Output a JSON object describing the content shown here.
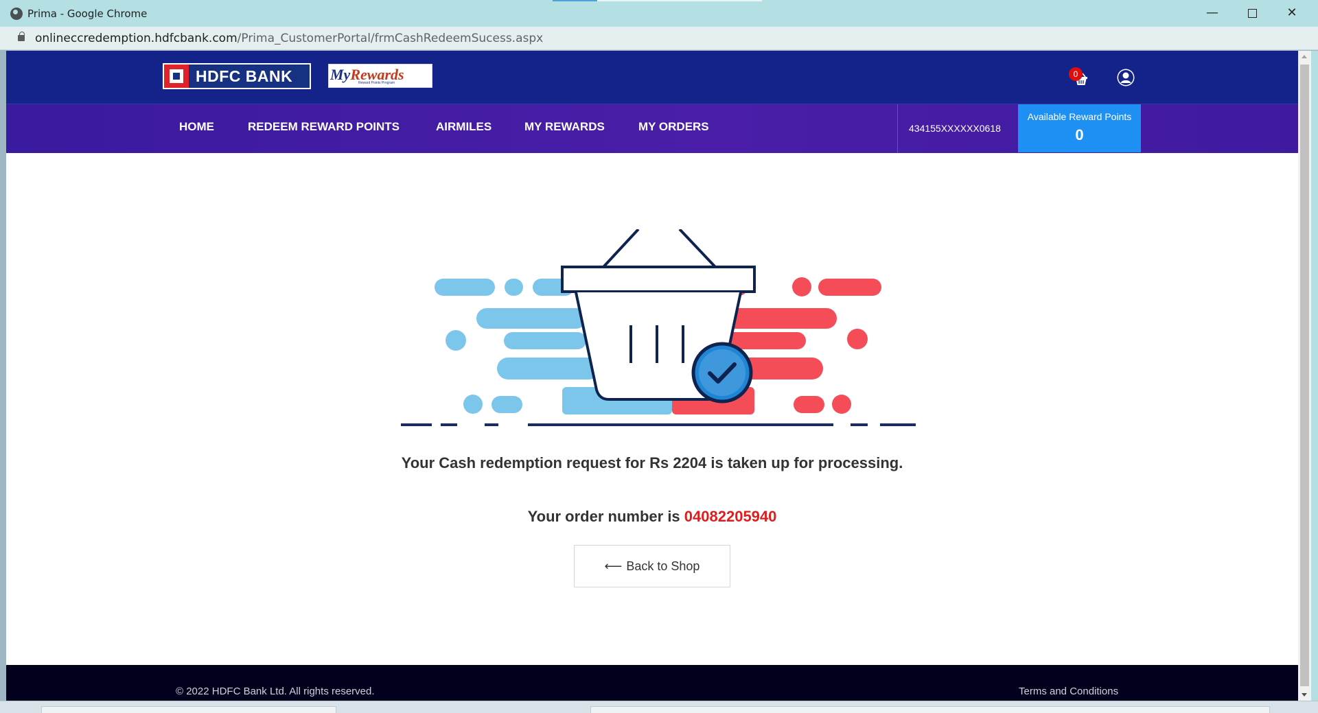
{
  "window": {
    "title": "Prima - Google Chrome",
    "url_host": "onlineccredemption.hdfcbank.com",
    "url_path": "/Prima_CustomerPortal/frmCashRedeemSucess.aspx"
  },
  "header": {
    "bank_name": "HDFC BANK",
    "rewards_logo_my": "My",
    "rewards_logo_rest": "Rewards",
    "rewards_logo_sub": "Reward Points Program",
    "cart_count": "0",
    "icons": [
      "shopping-basket-icon",
      "user-icon"
    ]
  },
  "nav": {
    "items": [
      "HOME",
      "REDEEM REWARD POINTS",
      "AIRMILES",
      "MY REWARDS",
      "MY ORDERS"
    ],
    "card_number": "434155XXXXXX0618",
    "reward_label": "Available Reward Points",
    "reward_points": "0"
  },
  "main": {
    "message": "Your Cash redemption request for Rs 2204 is taken up for processing.",
    "order_prefix": "Your order number is",
    "order_number": "04082205940",
    "back_arrow": "⟵",
    "back_label": "Back to Shop"
  },
  "footer": {
    "copyright": "© 2022 HDFC Bank Ltd. All rights reserved.",
    "terms": "Terms and Conditions"
  },
  "colors": {
    "header_bg": "#13238a",
    "nav_bg": "#4a1ea8",
    "reward_box": "#1f90f3",
    "order_red": "#e01d1d",
    "art_blue": "#7cc6ec",
    "art_red": "#f44d57",
    "footer_bg": "#01011e"
  }
}
